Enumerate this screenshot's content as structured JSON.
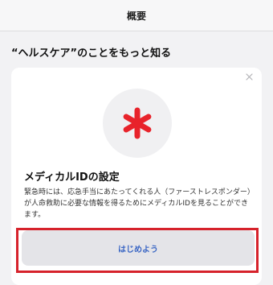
{
  "header": {
    "title": "概要"
  },
  "section": {
    "heading": "“ヘルスケア”のことをもっと知る"
  },
  "card": {
    "close_icon": "close-icon",
    "emblem_icon": "medical-asterisk-icon",
    "title": "メディカルIDの設定",
    "description": "緊急時には、応急手当にあたってくれる人（ファーストレスポンダー）が人命救助に必要な情報を得るためにメディカルIDを見ることができます。",
    "button_label": "はじめよう"
  },
  "colors": {
    "accent": "#3a66c4",
    "asterisk": "#e8232b",
    "highlight": "#d6222b",
    "background": "#f2f2f4"
  }
}
